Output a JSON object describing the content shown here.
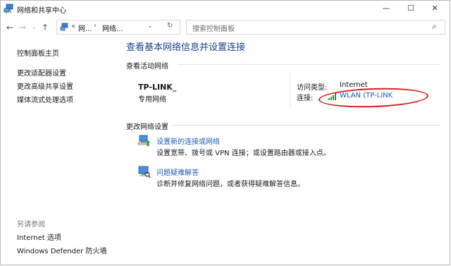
{
  "window": {
    "title": "网络和共享中心",
    "minimize_glyph": "—",
    "maximize_glyph": "☐",
    "close_glyph": "✕"
  },
  "nav": {
    "back_glyph": "←",
    "forward_glyph": "→",
    "dropdown_glyph": "⌄",
    "up_glyph": "↑",
    "breadcrumb_overflow": "«",
    "breadcrumb": [
      "网...",
      "网络..."
    ],
    "breadcrumb_sep": "›",
    "refresh_glyph": "↻",
    "search_placeholder": "搜索控制面板",
    "search_glyph": "⌕"
  },
  "sidebar": {
    "items": [
      {
        "label": "控制面板主页"
      },
      {
        "label": "更改适配器设置"
      },
      {
        "label": "更改高级共享设置"
      },
      {
        "label": "媒体流式处理选项"
      }
    ],
    "see_also_label": "另请参阅",
    "see_also": [
      {
        "label": "Internet 选项"
      },
      {
        "label": "Windows Defender 防火墙"
      }
    ]
  },
  "main": {
    "heading": "查看基本网络信息并设置连接",
    "active_networks_label": "查看活动网络",
    "network": {
      "name": "TP-LINK_",
      "type": "专用网络",
      "access_type_label": "访问类型:",
      "access_type_value": "Internet",
      "connections_label": "连接:",
      "connection_value": "WLAN (TP-LINK"
    },
    "change_settings_label": "更改网络设置",
    "tasks": [
      {
        "title": "设置新的连接或网络",
        "desc": "设置宽带、拨号或 VPN 连接；或设置路由器或接入点。"
      },
      {
        "title": "问题疑难解答",
        "desc": "诊断并修复网络问题，或者获得疑难解答信息。"
      }
    ]
  },
  "colors": {
    "accent_blue": "#1e3f8a",
    "link_blue": "#1f5cb8",
    "annotation_red": "#d91d1d",
    "signal_green": "#2e9a2e"
  }
}
